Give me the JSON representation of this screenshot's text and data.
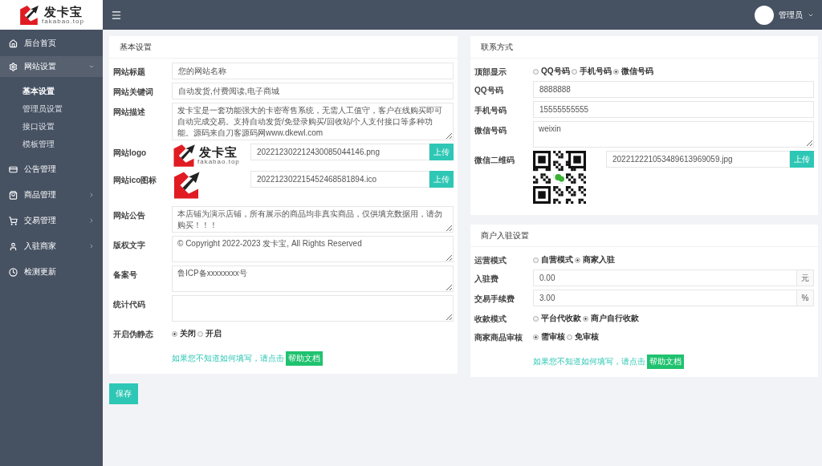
{
  "brand": {
    "name": "发卡宝",
    "domain": "fakabao.top"
  },
  "header": {
    "user": "管理员"
  },
  "sidebar": [
    {
      "label": "后台首页"
    },
    {
      "label": "网站设置",
      "expanded": true,
      "children": [
        {
          "label": "基本设置",
          "selected": true
        },
        {
          "label": "管理员设置",
          "selected": false
        },
        {
          "label": "接口设置",
          "selected": false
        },
        {
          "label": "模板管理",
          "selected": false
        }
      ]
    },
    {
      "label": "公告管理"
    },
    {
      "label": "商品管理",
      "expanded": false
    },
    {
      "label": "交易管理",
      "expanded": false
    },
    {
      "label": "入驻商家",
      "expanded": false
    },
    {
      "label": "检测更新"
    }
  ],
  "panels": [
    {
      "title": "基本设置",
      "rows": [
        {
          "kind": "input",
          "label": "网站标题",
          "value": "您的网站名称"
        },
        {
          "kind": "input",
          "label": "网站关键词",
          "value": "自动发货,付费阅读,电子商城"
        },
        {
          "kind": "textarea",
          "label": "网站描述",
          "value": "发卡宝是一套功能强大的卡密寄售系统，无需人工值守，客户在线购买即可自动完成交易。支持自动发货/免登录购买/回收站/个人支付接口等多种功能。源码来自刀客源码网www.dkewl.com"
        },
        {
          "kind": "logo_upload",
          "label": "网站logo",
          "logo_name": "发卡宝",
          "logo_domain": "fakabao.top",
          "value": "202212302212430085044146.png",
          "button": "上传"
        },
        {
          "kind": "icon_upload",
          "label": "网站ico图标",
          "value": "202212302215452468581894.ico",
          "button": "上传"
        },
        {
          "kind": "textarea",
          "label": "网站公告",
          "value": "本店铺为演示店铺，所有展示的商品均非真实商品，仅供填充数据用，请勿购买！！！"
        },
        {
          "kind": "textarea",
          "label": "版权文字",
          "value": "© Copyright 2022-2023 发卡宝, All Rights Reserved"
        },
        {
          "kind": "textarea",
          "label": "备案号",
          "value": "鲁ICP备xxxxxxxx号"
        },
        {
          "kind": "textarea",
          "label": "统计代码"
        },
        {
          "kind": "radio",
          "label": "开启伪静态",
          "options": [
            {
              "label": "关闭",
              "selected": true
            },
            {
              "label": "开启",
              "selected": false
            }
          ]
        }
      ],
      "help": {
        "text": "如果您不知道如何填写，请点击",
        "button": "帮助文档"
      }
    },
    {
      "title": "联系方式",
      "rows": [
        {
          "kind": "radio",
          "label": "顶部显示",
          "options": [
            {
              "label": "QQ号码",
              "selected": false
            },
            {
              "label": "手机号码",
              "selected": false
            },
            {
              "label": "微信号码",
              "selected": true
            }
          ]
        },
        {
          "kind": "input",
          "label": "QQ号码",
          "value": "8888888"
        },
        {
          "kind": "input",
          "label": "手机号码",
          "value": "15555555555"
        },
        {
          "kind": "textarea",
          "label": "微信号码",
          "value": "weixin"
        },
        {
          "kind": "qr_upload",
          "label": "微信二维码",
          "value": "202212221053489613969059.jpg",
          "button": "上传"
        }
      ]
    },
    {
      "title": "商户入驻设置",
      "rows": [
        {
          "kind": "radio",
          "label": "运营模式",
          "options": [
            {
              "label": "自营模式",
              "selected": false
            },
            {
              "label": "商家入驻",
              "selected": true
            }
          ]
        },
        {
          "kind": "input",
          "label": "入驻费",
          "value": "0.00",
          "addon": "元"
        },
        {
          "kind": "input",
          "label": "交易手续费",
          "value": "3.00",
          "addon": "%"
        },
        {
          "kind": "radio",
          "label": "收款模式",
          "options": [
            {
              "label": "平台代收款",
              "selected": false
            },
            {
              "label": "商户自行收款",
              "selected": true
            }
          ]
        },
        {
          "kind": "radio",
          "label": "商家商品审核",
          "options": [
            {
              "label": "需审核",
              "selected": true
            },
            {
              "label": "免审核",
              "selected": false
            }
          ]
        }
      ],
      "help": {
        "text": "如果您不知道如何填写，请点击",
        "button": "帮助文档"
      }
    }
  ],
  "save_button": "保存"
}
